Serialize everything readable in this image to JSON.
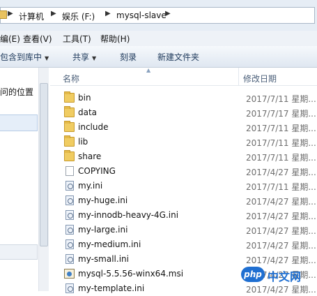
{
  "address": {
    "crumbs": [
      "计算机",
      "娱乐 (F:)",
      "mysql-slave"
    ]
  },
  "menu": {
    "edit": "编(E)",
    "view": "查看(V)",
    "tools": "工具(T)",
    "help": "帮助(H)"
  },
  "toolbar": {
    "include_in_library": "包含到库中",
    "share": "共享",
    "burn": "刻录",
    "new_folder": "新建文件夹"
  },
  "nav": {
    "recent_places": "问的位置"
  },
  "columns": {
    "name": "名称",
    "modified": "修改日期"
  },
  "files": [
    {
      "name": "bin",
      "date": "2017/7/11 星期...",
      "icon": "folder-icon"
    },
    {
      "name": "data",
      "date": "2017/7/17 星期...",
      "icon": "folder-icon"
    },
    {
      "name": "include",
      "date": "2017/7/11 星期...",
      "icon": "folder-icon"
    },
    {
      "name": "lib",
      "date": "2017/7/11 星期...",
      "icon": "folder-icon"
    },
    {
      "name": "share",
      "date": "2017/7/11 星期...",
      "icon": "folder-icon"
    },
    {
      "name": "COPYING",
      "date": "2017/4/27 星期...",
      "icon": "file-icon"
    },
    {
      "name": "my.ini",
      "date": "2017/7/11 星期...",
      "icon": "ini-file-icon"
    },
    {
      "name": "my-huge.ini",
      "date": "2017/4/27 星期...",
      "icon": "ini-file-icon"
    },
    {
      "name": "my-innodb-heavy-4G.ini",
      "date": "2017/4/27 星期...",
      "icon": "ini-file-icon"
    },
    {
      "name": "my-large.ini",
      "date": "2017/4/27 星期...",
      "icon": "ini-file-icon"
    },
    {
      "name": "my-medium.ini",
      "date": "2017/4/27 星期...",
      "icon": "ini-file-icon"
    },
    {
      "name": "my-small.ini",
      "date": "2017/4/27 星期...",
      "icon": "ini-file-icon"
    },
    {
      "name": "mysql-5.5.56-winx64.msi",
      "date": "2017/4/27 星期...",
      "icon": "msi-installer-icon"
    },
    {
      "name": "my-template.ini",
      "date": "2017/4/27 星期...",
      "icon": "ini-file-icon"
    }
  ],
  "watermark": {
    "logo": "php",
    "text": "中文网"
  }
}
